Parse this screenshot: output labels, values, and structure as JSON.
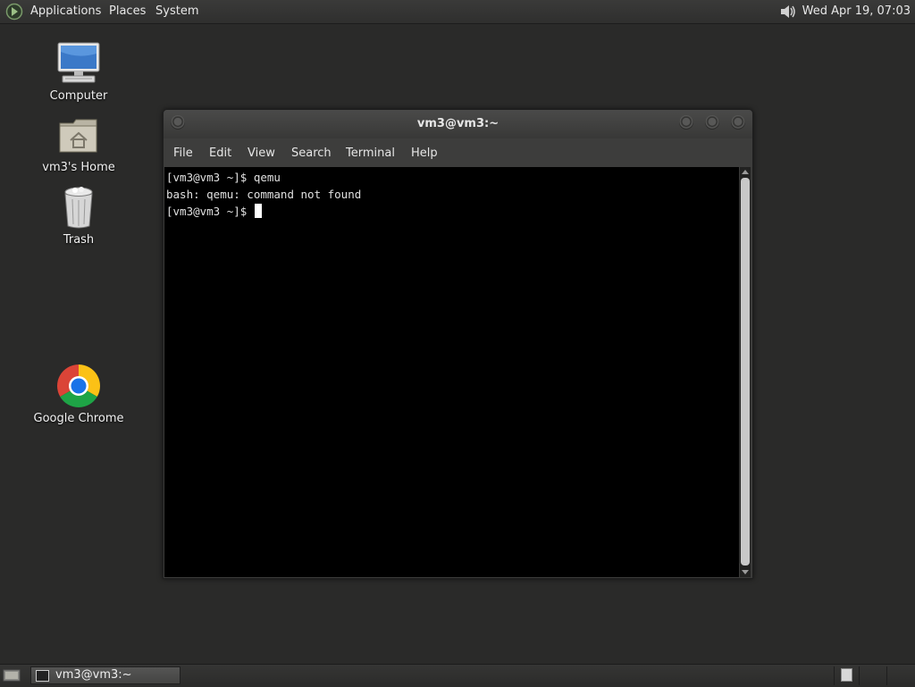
{
  "top_panel": {
    "menus": [
      "Applications",
      "Places",
      "System"
    ],
    "clock": "Wed Apr 19, 07:03",
    "logo_icon": "mate-menu-icon",
    "volume_icon": "speaker-icon"
  },
  "desktop": {
    "icons": [
      {
        "label": "Computer",
        "icon": "computer-icon"
      },
      {
        "label": "vm3's Home",
        "icon": "home-folder-icon"
      },
      {
        "label": "Trash",
        "icon": "trash-icon"
      },
      {
        "label": "Google Chrome",
        "icon": "chrome-icon"
      }
    ]
  },
  "terminal": {
    "title": "vm3@vm3:~",
    "menu": [
      "File",
      "Edit",
      "View",
      "Search",
      "Terminal",
      "Help"
    ],
    "lines": [
      "[vm3@vm3 ~]$ qemu",
      "bash: qemu: command not found",
      "[vm3@vm3 ~]$ "
    ]
  },
  "taskbar": {
    "tasks": [
      {
        "label": "vm3@vm3:~",
        "icon": "terminal-icon"
      }
    ]
  },
  "colors": {
    "desktop_bg": "#2a2a29",
    "panel_bg": "#353534",
    "terminal_bg": "#000000",
    "terminal_fg": "#e0e0e0"
  }
}
